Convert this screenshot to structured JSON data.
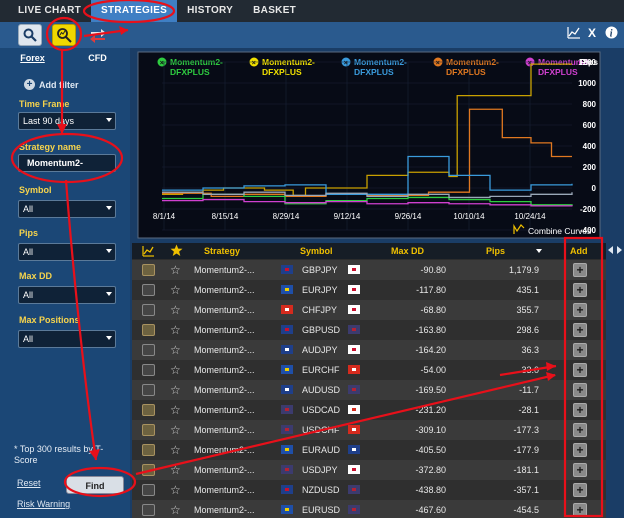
{
  "nav": {
    "tabs": [
      "LIVE CHART",
      "STRATEGIES",
      "HISTORY",
      "BASKET"
    ]
  },
  "sidebar": {
    "tabs": [
      "Forex",
      "CFD"
    ],
    "add_filter": "Add filter",
    "time_frame_label": "Time Frame",
    "time_frame_value": "Last 90 days",
    "strategy_name_label": "Strategy name",
    "strategy_name_value": "Momentum2-",
    "symbol_label": "Symbol",
    "symbol_value": "All",
    "pips_label": "Pips",
    "pips_value": "All",
    "maxdd_label": "Max DD",
    "maxdd_value": "All",
    "maxpos_label": "Max Positions",
    "maxpos_value": "All",
    "top300": "* Top 300 results by T-Score",
    "reset": "Reset",
    "find": "Find",
    "risk": "Risk Warning"
  },
  "chart": {
    "combine_curves": "Combine Curves",
    "unit": "Pips"
  },
  "chart_data": {
    "type": "line",
    "x_labels": [
      "8/1/14",
      "8/15/14",
      "8/29/14",
      "9/12/14",
      "9/26/14",
      "10/10/14",
      "10/24/14"
    ],
    "y_ticks": [
      1200,
      1000,
      800,
      600,
      400,
      200,
      0,
      -200,
      -400
    ],
    "ylim": [
      -400,
      1200
    ],
    "legend": [
      {
        "name": "Momentum2-DFXPLUS",
        "color": "#2ecc40"
      },
      {
        "name": "Momentum2-DFXPLUS",
        "color": "#f0e000"
      },
      {
        "name": "Momentum2-DFXPLUS",
        "color": "#3a9bdc"
      },
      {
        "name": "Momentum2-DFXPLUS",
        "color": "#e07820"
      },
      {
        "name": "Momentum2-DFXPLUS",
        "color": "#d040d0"
      }
    ],
    "series": [
      {
        "color": "#c8a000",
        "points": [
          [
            0,
            -60
          ],
          [
            0.05,
            -40
          ],
          [
            0.1,
            -20
          ],
          [
            0.15,
            0
          ],
          [
            0.25,
            -20
          ],
          [
            0.32,
            -70
          ],
          [
            0.35,
            0
          ],
          [
            0.45,
            0
          ],
          [
            0.5,
            120
          ],
          [
            0.55,
            120
          ],
          [
            0.6,
            150
          ],
          [
            0.65,
            150
          ],
          [
            0.7,
            110
          ],
          [
            0.72,
            880
          ],
          [
            0.85,
            880
          ],
          [
            0.87,
            880
          ],
          [
            0.9,
            1180
          ],
          [
            1,
            1180
          ]
        ]
      },
      {
        "color": "#e07820",
        "points": [
          [
            0,
            -50
          ],
          [
            0.12,
            -80
          ],
          [
            0.2,
            -60
          ],
          [
            0.3,
            -80
          ],
          [
            0.4,
            -60
          ],
          [
            0.5,
            -70
          ],
          [
            0.65,
            -40
          ],
          [
            0.72,
            -40
          ],
          [
            0.75,
            750
          ],
          [
            0.8,
            750
          ],
          [
            0.83,
            480
          ],
          [
            0.86,
            480
          ],
          [
            0.9,
            430
          ],
          [
            0.95,
            300
          ],
          [
            1,
            300
          ]
        ]
      },
      {
        "color": "#3a9bdc",
        "points": [
          [
            0,
            -20
          ],
          [
            0.1,
            0
          ],
          [
            0.2,
            20
          ],
          [
            0.3,
            30
          ],
          [
            0.4,
            -60
          ],
          [
            0.5,
            -60
          ],
          [
            0.6,
            300
          ],
          [
            0.65,
            300
          ],
          [
            0.7,
            120
          ],
          [
            0.75,
            120
          ],
          [
            0.8,
            -20
          ],
          [
            0.9,
            30
          ],
          [
            1,
            40
          ]
        ]
      },
      {
        "color": "#2ecc40",
        "points": [
          [
            0,
            -100
          ],
          [
            0.1,
            -60
          ],
          [
            0.2,
            -80
          ],
          [
            0.3,
            -150
          ],
          [
            0.4,
            -120
          ],
          [
            0.5,
            -100
          ],
          [
            0.6,
            -90
          ],
          [
            0.7,
            -110
          ],
          [
            0.8,
            -130
          ],
          [
            0.9,
            -160
          ],
          [
            1,
            -170
          ]
        ]
      },
      {
        "color": "#d040d0",
        "points": [
          [
            0,
            -120
          ],
          [
            0.1,
            -110
          ],
          [
            0.2,
            -130
          ],
          [
            0.3,
            -140
          ],
          [
            0.4,
            -130
          ],
          [
            0.5,
            -150
          ],
          [
            0.6,
            -140
          ],
          [
            0.7,
            -150
          ],
          [
            0.8,
            -160
          ],
          [
            0.9,
            -170
          ],
          [
            1,
            -175
          ]
        ]
      },
      {
        "color": "#9aa8b8",
        "points": [
          [
            0,
            -40
          ],
          [
            0.1,
            -60
          ],
          [
            0.2,
            -40
          ],
          [
            0.3,
            -70
          ],
          [
            0.4,
            -50
          ],
          [
            0.5,
            -80
          ],
          [
            0.6,
            -60
          ],
          [
            0.7,
            -90
          ],
          [
            0.8,
            -80
          ],
          [
            0.9,
            -60
          ],
          [
            1,
            -40
          ]
        ]
      }
    ]
  },
  "table": {
    "headers": [
      "Strategy",
      "Symbol",
      "Max DD",
      "Pips",
      "Add"
    ],
    "rows": [
      {
        "strategy": "Momentum2-...",
        "symbol": "GBPJPY",
        "maxdd": "-90.80",
        "pips": "1,179.9",
        "f1": "gb",
        "f2": "jp",
        "chart": true
      },
      {
        "strategy": "Momentum2-...",
        "symbol": "EURJPY",
        "maxdd": "-117.80",
        "pips": "435.1",
        "f1": "eu",
        "f2": "jp",
        "chart": false
      },
      {
        "strategy": "Momentum2-...",
        "symbol": "CHFJPY",
        "maxdd": "-68.80",
        "pips": "355.7",
        "f1": "ch",
        "f2": "jp",
        "chart": false
      },
      {
        "strategy": "Momentum2-...",
        "symbol": "GBPUSD",
        "maxdd": "-163.80",
        "pips": "298.6",
        "f1": "gb",
        "f2": "us",
        "chart": true
      },
      {
        "strategy": "Momentum2-...",
        "symbol": "AUDJPY",
        "maxdd": "-164.20",
        "pips": "36.3",
        "f1": "au",
        "f2": "jp",
        "chart": false
      },
      {
        "strategy": "Momentum2-...",
        "symbol": "EURCHF",
        "maxdd": "-54.00",
        "pips": "33.0",
        "f1": "eu",
        "f2": "ch",
        "chart": false
      },
      {
        "strategy": "Momentum2-...",
        "symbol": "AUDUSD",
        "maxdd": "-169.50",
        "pips": "-11.7",
        "f1": "au",
        "f2": "us",
        "chart": false
      },
      {
        "strategy": "Momentum2-...",
        "symbol": "USDCAD",
        "maxdd": "-231.20",
        "pips": "-28.1",
        "f1": "us",
        "f2": "ca",
        "chart": true
      },
      {
        "strategy": "Momentum2-...",
        "symbol": "USDCHF",
        "maxdd": "-309.10",
        "pips": "-177.3",
        "f1": "us",
        "f2": "ch",
        "chart": true
      },
      {
        "strategy": "Momentum2-...",
        "symbol": "EURAUD",
        "maxdd": "-405.50",
        "pips": "-177.9",
        "f1": "eu",
        "f2": "au",
        "chart": true
      },
      {
        "strategy": "Momentum2-...",
        "symbol": "USDJPY",
        "maxdd": "-372.80",
        "pips": "-181.1",
        "f1": "us",
        "f2": "jp",
        "chart": true
      },
      {
        "strategy": "Momentum2-...",
        "symbol": "NZDUSD",
        "maxdd": "-438.80",
        "pips": "-357.1",
        "f1": "nz",
        "f2": "us",
        "chart": false
      },
      {
        "strategy": "Momentum2-...",
        "symbol": "EURUSD",
        "maxdd": "-467.60",
        "pips": "-454.5",
        "f1": "eu",
        "f2": "us",
        "chart": false
      }
    ]
  },
  "colors": {
    "accent": "#3f7fc4",
    "label_yellow": "#f7d44c",
    "annotation_red": "#e8101a"
  }
}
